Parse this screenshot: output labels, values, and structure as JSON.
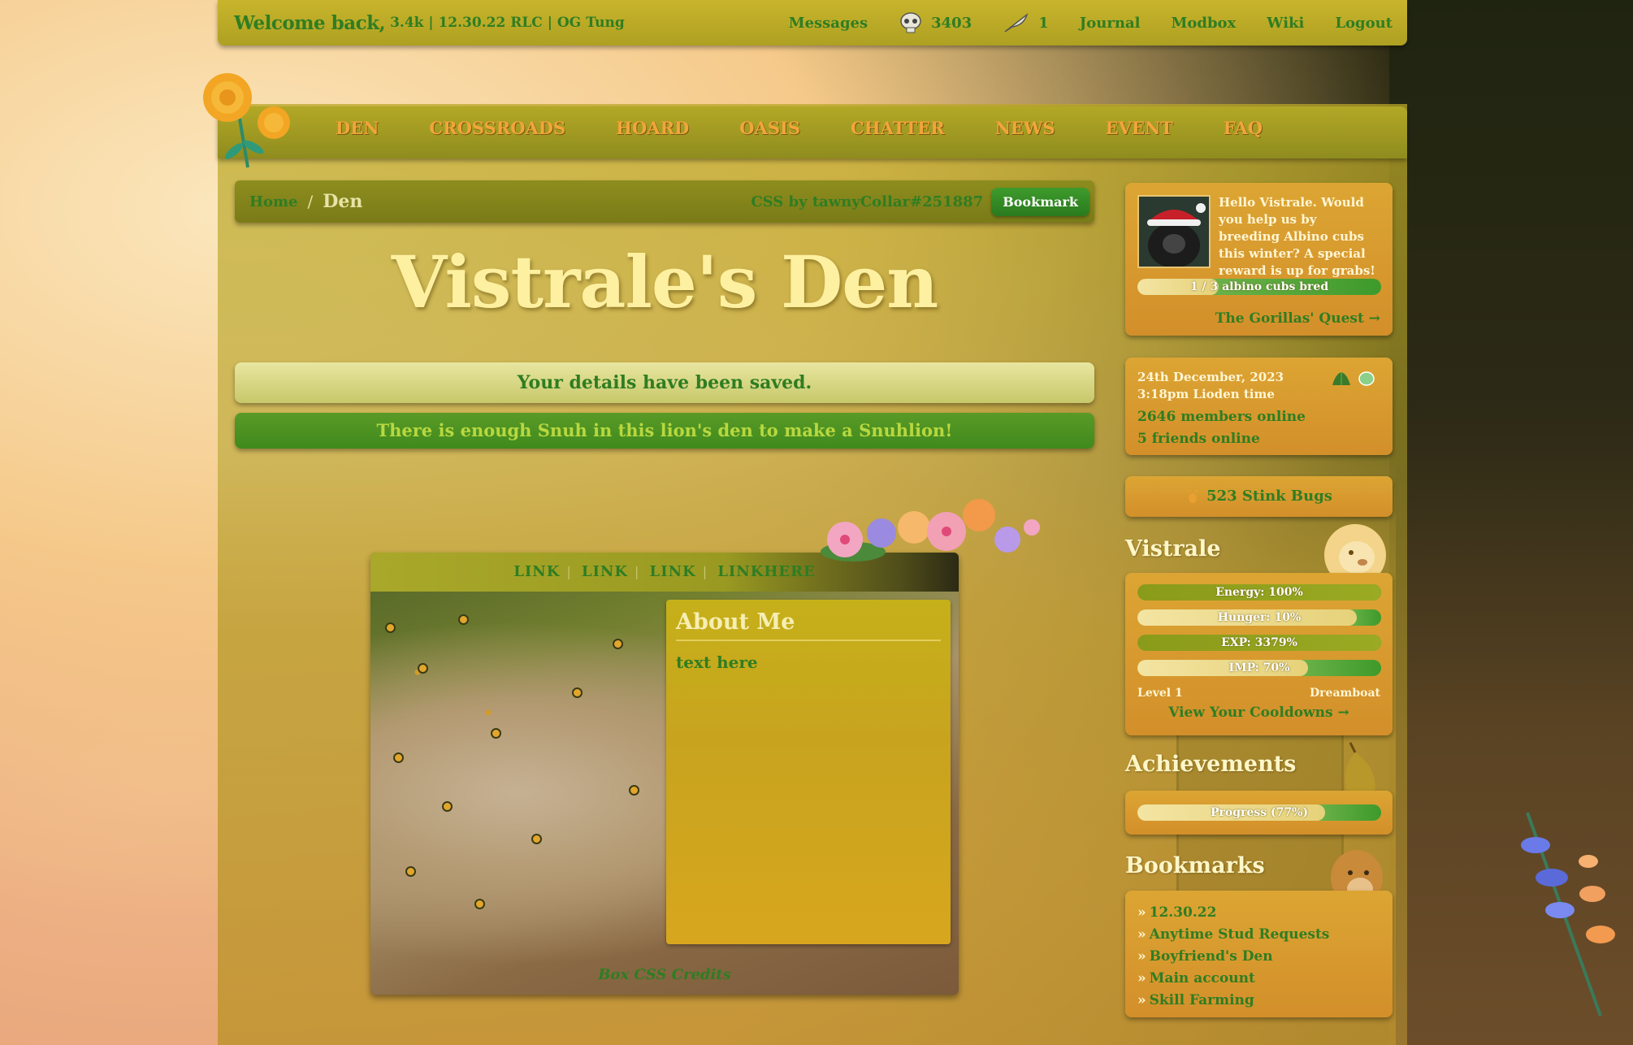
{
  "topbar": {
    "welcome": "Welcome back,",
    "sub": "3.4k | 12.30.22 RLC | OG Tung",
    "messages": "Messages",
    "skull_count": "3403",
    "feather_count": "1",
    "journal": "Journal",
    "modbox": "Modbox",
    "wiki": "Wiki",
    "logout": "Logout"
  },
  "nav": [
    "DEN",
    "CROSSROADS",
    "HOARD",
    "OASIS",
    "CHATTER",
    "NEWS",
    "EVENT",
    "FAQ"
  ],
  "breadcrumb": {
    "home": "Home",
    "separator": "/",
    "current": "Den",
    "credit": "CSS by tawnyCollar#251887",
    "bookmark": "Bookmark"
  },
  "page_title": "Vistrale's Den",
  "notices": {
    "saved": "Your details have been saved.",
    "snuh": "There is enough Snuh in this lion's den to make a Snuhlion!"
  },
  "box": {
    "links": [
      "LINK",
      "LINK",
      "LINK",
      "LINKHERE"
    ],
    "about_title": "About Me",
    "about_text": "text here",
    "credit": "Box CSS Credits"
  },
  "quest": {
    "text": "Hello Vistrale. Would you help us by breeding Albino cubs this winter? A special reward is up for grabs!",
    "progress_label": "1 / 3 albino cubs bred",
    "progress": 0.333,
    "link": "The Gorillas' Quest →"
  },
  "time": {
    "date": "24th December, 2023",
    "time": "3:18pm Lioden time",
    "members_online": "2646 members online",
    "friends_online": "5 friends online"
  },
  "stink": "523 Stink Bugs",
  "lion": {
    "name": "Vistrale",
    "energy": "Energy: 100%",
    "energy_value": 1.0,
    "hunger": "Hunger: 10%",
    "hunger_value": 0.9,
    "exp": "EXP: 3379%",
    "exp_value": 1.0,
    "imp": "IMP: 70%",
    "imp_value": 0.7,
    "level": "Level 1",
    "rank": "Dreamboat",
    "cooldowns": "View Your Cooldowns →"
  },
  "achievements": {
    "title": "Achievements",
    "progress_label": "Progress (77%)",
    "progress": 0.77
  },
  "bookmarks": {
    "title": "Bookmarks",
    "items": [
      "12.30.22",
      "Anytime Stud Requests",
      "Boyfriend's Den",
      "Main account",
      "Skill Farming"
    ]
  },
  "colors": {
    "link_green": "#2f7d22",
    "nav_orange": "#f2a53a",
    "panel_orange": "#d9a030",
    "bar_olive": "#b3a826"
  },
  "icons": [
    "skull-icon",
    "feather-icon",
    "leaf-icon",
    "stink-bug-icon"
  ]
}
